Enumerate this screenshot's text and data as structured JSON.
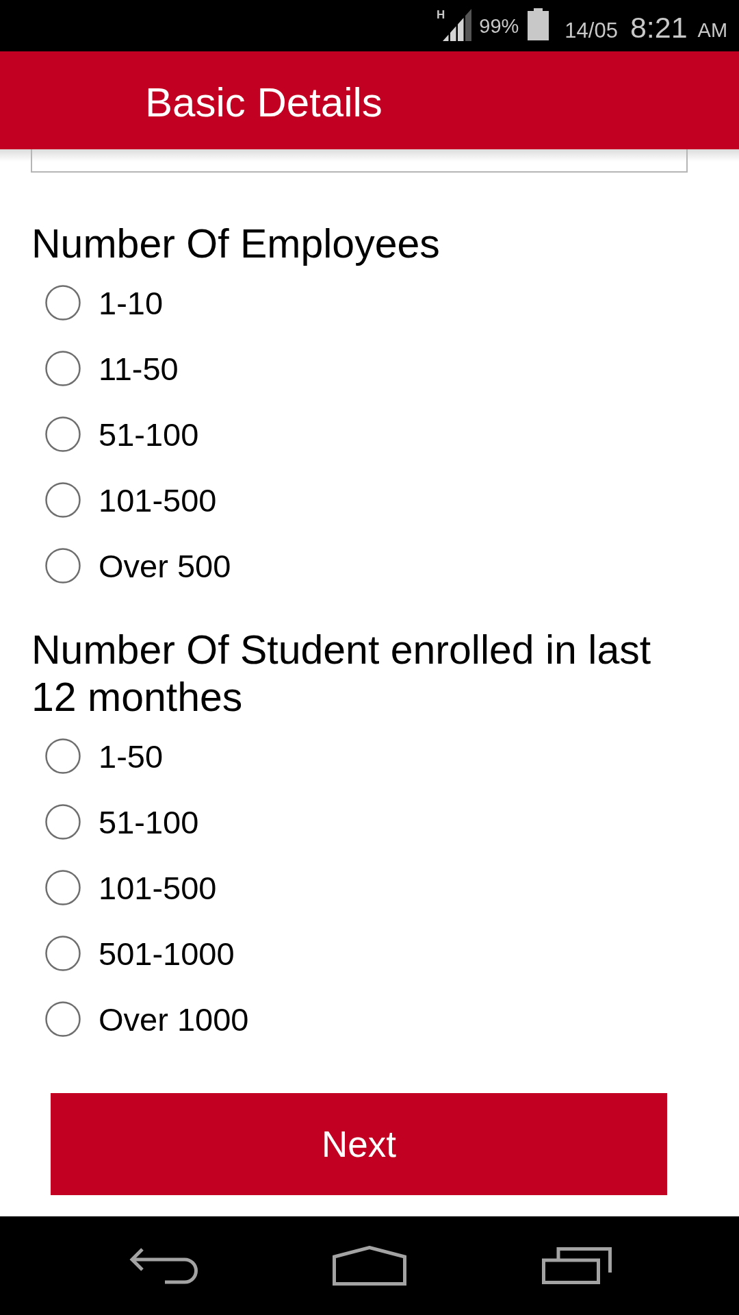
{
  "status_bar": {
    "network_type": "H",
    "battery": "99%",
    "date": "14/05",
    "time": "8:21",
    "period": "AM"
  },
  "app_bar": {
    "title": "Basic Details"
  },
  "questions": [
    {
      "label": "Number Of Employees",
      "options": [
        {
          "label": "1-10",
          "selected": false
        },
        {
          "label": "11-50",
          "selected": false
        },
        {
          "label": "51-100",
          "selected": false
        },
        {
          "label": "101-500",
          "selected": false
        },
        {
          "label": "Over 500",
          "selected": false
        }
      ]
    },
    {
      "label": "Number Of Student enrolled in last 12 monthes",
      "options": [
        {
          "label": "1-50",
          "selected": false
        },
        {
          "label": "51-100",
          "selected": false
        },
        {
          "label": "101-500",
          "selected": false
        },
        {
          "label": "501-1000",
          "selected": false
        },
        {
          "label": "Over 1000",
          "selected": false
        }
      ]
    }
  ],
  "next_button": {
    "label": "Next"
  }
}
